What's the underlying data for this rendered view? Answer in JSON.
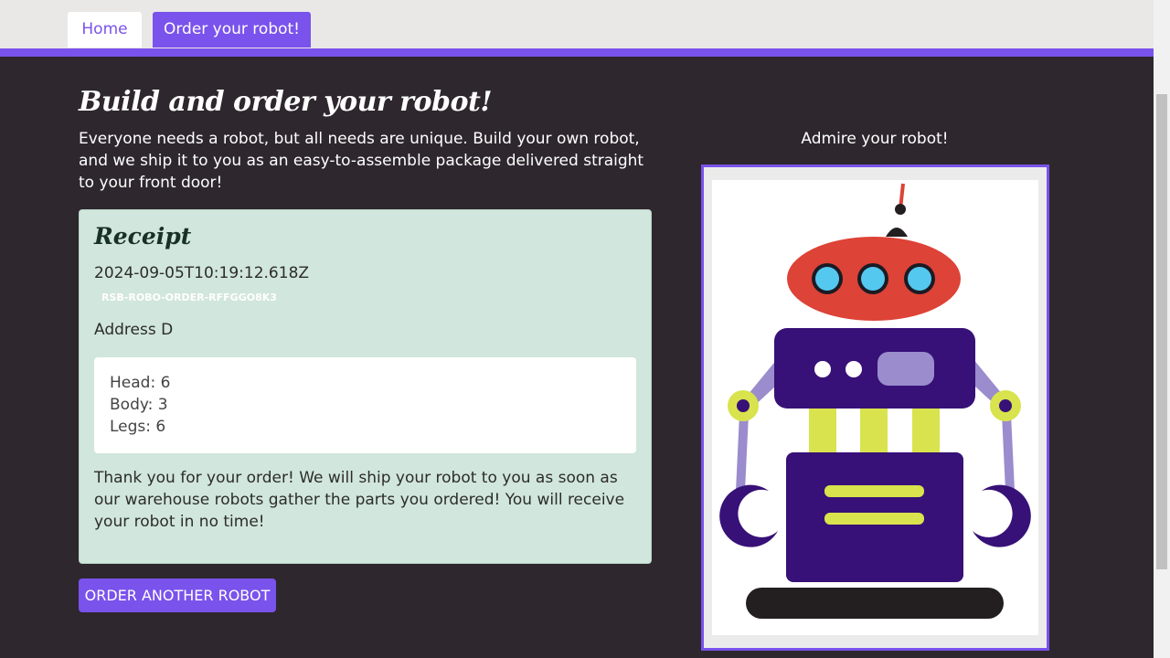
{
  "nav": {
    "tabs": [
      {
        "label": "Home"
      },
      {
        "label": "Order your robot!"
      }
    ]
  },
  "main": {
    "title": "Build and order your robot!",
    "intro": "Everyone needs a robot, but all needs are unique. Build your own robot, and we ship it to you as an easy-to-assemble package delivered straight to your front door!",
    "receipt": {
      "title": "Receipt",
      "timestamp": "2024-09-05T10:19:12.618Z",
      "order_id": "RSB-ROBO-ORDER-RFFGGO8K3",
      "address": "Address D",
      "parts": {
        "head": "Head: 6",
        "body": "Body: 3",
        "legs": "Legs: 6"
      },
      "thank_you": "Thank you for your order! We will ship your robot to you as soon as our warehouse robots gather the parts you ordered! You will receive your robot in no time!"
    },
    "order_another_label": "ORDER ANOTHER ROBOT"
  },
  "preview": {
    "caption": "Admire your robot!",
    "colors": {
      "head": "#dd4337",
      "eye_ring": "#1b1b24",
      "eye": "#55c8ef",
      "body": "#371177",
      "arm": "#9a8ccd",
      "joint": "#d8e34d",
      "panel": "#9a8ccd",
      "base": "#231f20"
    }
  }
}
